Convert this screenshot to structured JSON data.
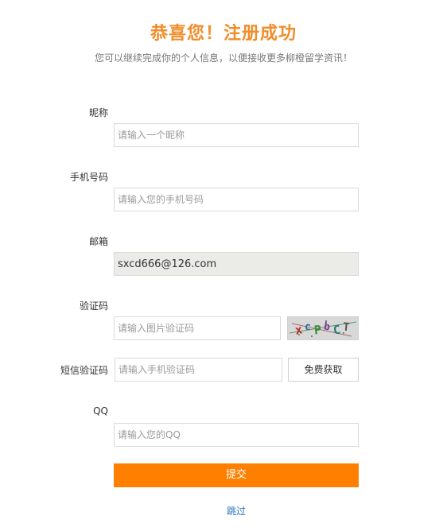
{
  "header": {
    "title": "恭喜您！注册成功",
    "subtitle": "您可以继续完成你的个人信息，以便接收更多柳橙留学资讯！"
  },
  "form": {
    "nickname": {
      "label": "昵称",
      "placeholder": "请输入一个昵称",
      "value": ""
    },
    "phone": {
      "label": "手机号码",
      "placeholder": "请输入您的手机号码",
      "value": ""
    },
    "email": {
      "label": "邮箱",
      "value": "sxcd666@126.com"
    },
    "captcha": {
      "label": "验证码",
      "placeholder": "请输入图片验证码",
      "value": "",
      "image_text": "XCPBCT"
    },
    "sms": {
      "label": "短信验证码",
      "placeholder": "请输入手机验证码",
      "value": "",
      "button_label": "免费获取"
    },
    "qq": {
      "label": "QQ",
      "placeholder": "请输入您的QQ",
      "value": ""
    }
  },
  "actions": {
    "submit_label": "提交",
    "skip_label": "跳过"
  },
  "colors": {
    "title": "#f08d2a",
    "submit": "#ff8000",
    "link": "#2a73c0"
  }
}
